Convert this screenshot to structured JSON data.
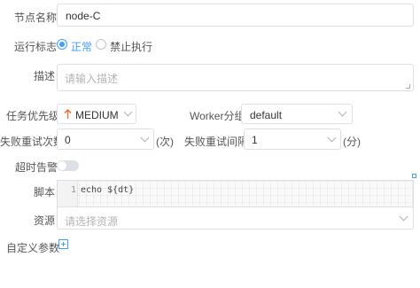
{
  "node_name": {
    "label": "节点名称",
    "value": "node-C"
  },
  "run_flag": {
    "label": "运行标志",
    "options": [
      "正常",
      "禁止执行"
    ],
    "selected": "正常"
  },
  "description": {
    "label": "描述",
    "placeholder": "请输入描述"
  },
  "priority": {
    "label": "任务优先级",
    "value": "MEDIUM",
    "icon": "arrow-up-icon",
    "icon_color": "#f56c2d"
  },
  "worker_group": {
    "label": "Worker分组",
    "value": "default"
  },
  "retry_times": {
    "label": "失败重试次数",
    "value": "0",
    "unit": "(次)"
  },
  "retry_interval": {
    "label": "失败重试间隔",
    "value": "1",
    "unit": "(分)"
  },
  "timeout_alarm": {
    "label": "超时告警",
    "enabled": false
  },
  "script": {
    "label": "脚本",
    "line_number": "1",
    "code": "echo ${dt}"
  },
  "resources": {
    "label": "资源",
    "placeholder": "请选择资源"
  },
  "custom_params": {
    "label": "自定义参数"
  },
  "colors": {
    "accent": "#409eff",
    "priority": "#f56c2d",
    "border": "#dcdfe6"
  }
}
